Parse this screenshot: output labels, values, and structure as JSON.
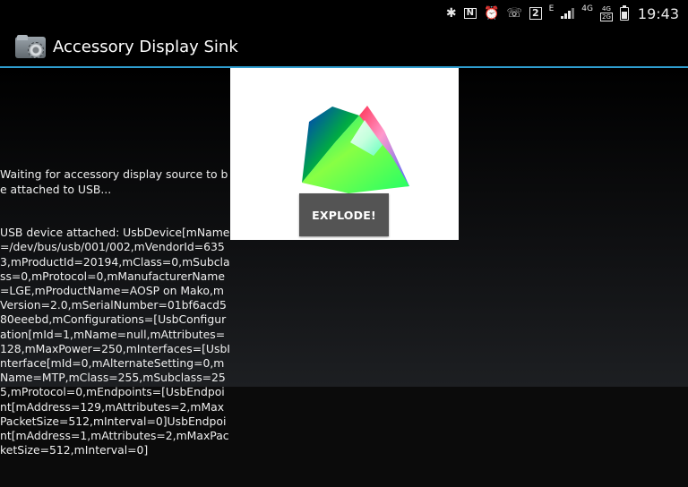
{
  "status_bar": {
    "icons": [
      "bluetooth-icon",
      "nfc-icon",
      "alarm-icon",
      "wifi-calling-icon",
      "sim-2-badge",
      "edge-network-icon",
      "signal-icon",
      "4g-icon",
      "network-stack-icon",
      "battery-icon"
    ],
    "sim_label": "2",
    "edge_label": "E",
    "network_4g_label": "4G",
    "stack_top": "4G",
    "stack_bottom": "2G",
    "time": "19:43"
  },
  "action_bar": {
    "title": "Accessory Display Sink",
    "accent_color": "#2f9ed0"
  },
  "log": {
    "lines": [
      "Waiting for accessory display source to be attached to USB...",
      "USB device attached: UsbDevice[mName=/dev/bus/usb/001/002,mVendorId=6353,mProductId=20194,mClass=0,mSubclass=0,mProtocol=0,mManufacturerName=LGE,mProductName=AOSP on Mako,mVersion=2.0,mSerialNumber=01bf6acd580eeebd,mConfigurations=[UsbConfiguration[mId=1,mName=null,mAttributes=128,mMaxPower=250,mInterfaces=[UsbInterface[mId=0,mAlternateSetting=0,mName=MTP,mClass=255,mSubclass=255,mProtocol=0,mEndpoints=[UsbEndpoint[mAddress=129,mAttributes=2,mMaxPacketSize=512,mInterval=0]UsbEndpoint[mAddress=1,mAttributes=2,mMaxPacketSize=512,mInterval=0]"
    ]
  },
  "presentation": {
    "button_label": "EXPLODE!"
  }
}
